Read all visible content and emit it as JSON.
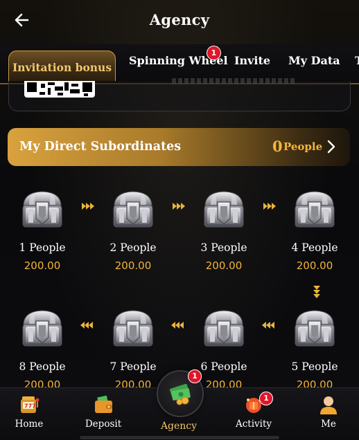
{
  "header": {
    "title": "Agency"
  },
  "tabs": [
    {
      "label": "Invitation bonus",
      "active": true
    },
    {
      "label": "Spinning Wheel",
      "badge": "1"
    },
    {
      "label": "Invite"
    },
    {
      "label": "My Data"
    }
  ],
  "subordinates": {
    "title": "My Direct Subordinates",
    "count": "0",
    "unit": "People"
  },
  "rewards": [
    {
      "label": "1 People",
      "amount": "200.00"
    },
    {
      "label": "2 People",
      "amount": "200.00"
    },
    {
      "label": "3 People",
      "amount": "200.00"
    },
    {
      "label": "4 People",
      "amount": "200.00"
    },
    {
      "label": "5 People",
      "amount": "200.00"
    },
    {
      "label": "6 People",
      "amount": "200.00"
    },
    {
      "label": "7 People",
      "amount": "200.00"
    },
    {
      "label": "8 People",
      "amount": "200.00"
    }
  ],
  "nav": {
    "home": {
      "label": "Home"
    },
    "deposit": {
      "label": "Deposit"
    },
    "agency": {
      "label": "Agency",
      "badge": "1"
    },
    "activity": {
      "label": "Activity",
      "badge": "1"
    },
    "me": {
      "label": "Me"
    }
  },
  "colors": {
    "accent": "#f2b53a",
    "badge": "#e0162b",
    "bar_start": "#d9a23e"
  }
}
